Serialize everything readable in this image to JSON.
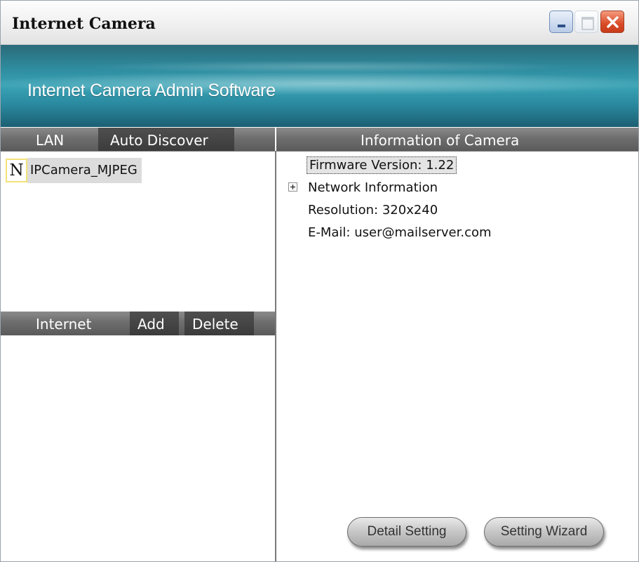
{
  "window": {
    "title": "Internet Camera"
  },
  "banner": {
    "title": "Internet Camera Admin Software"
  },
  "lan_bar": {
    "lan_label": "LAN",
    "auto_discover_label": "Auto Discover"
  },
  "info_bar": {
    "title": "Information of Camera"
  },
  "lan_list": [
    {
      "icon_letter": "N",
      "label": "IPCamera_MJPEG"
    }
  ],
  "internet_bar": {
    "label": "Internet",
    "add_label": "Add",
    "delete_label": "Delete"
  },
  "camera_info": {
    "firmware": "Firmware Version:  1.22",
    "network_expander": "+",
    "network": "Network Information",
    "resolution": "Resolution: 320x240",
    "email": "E-Mail: user@mailserver.com"
  },
  "buttons": {
    "detail_setting": "Detail Setting",
    "setting_wizard": "Setting Wizard"
  },
  "colors": {
    "banner": "#2e8b9e",
    "header_bar": "#6d6d6d",
    "close_button": "#d94b27"
  }
}
